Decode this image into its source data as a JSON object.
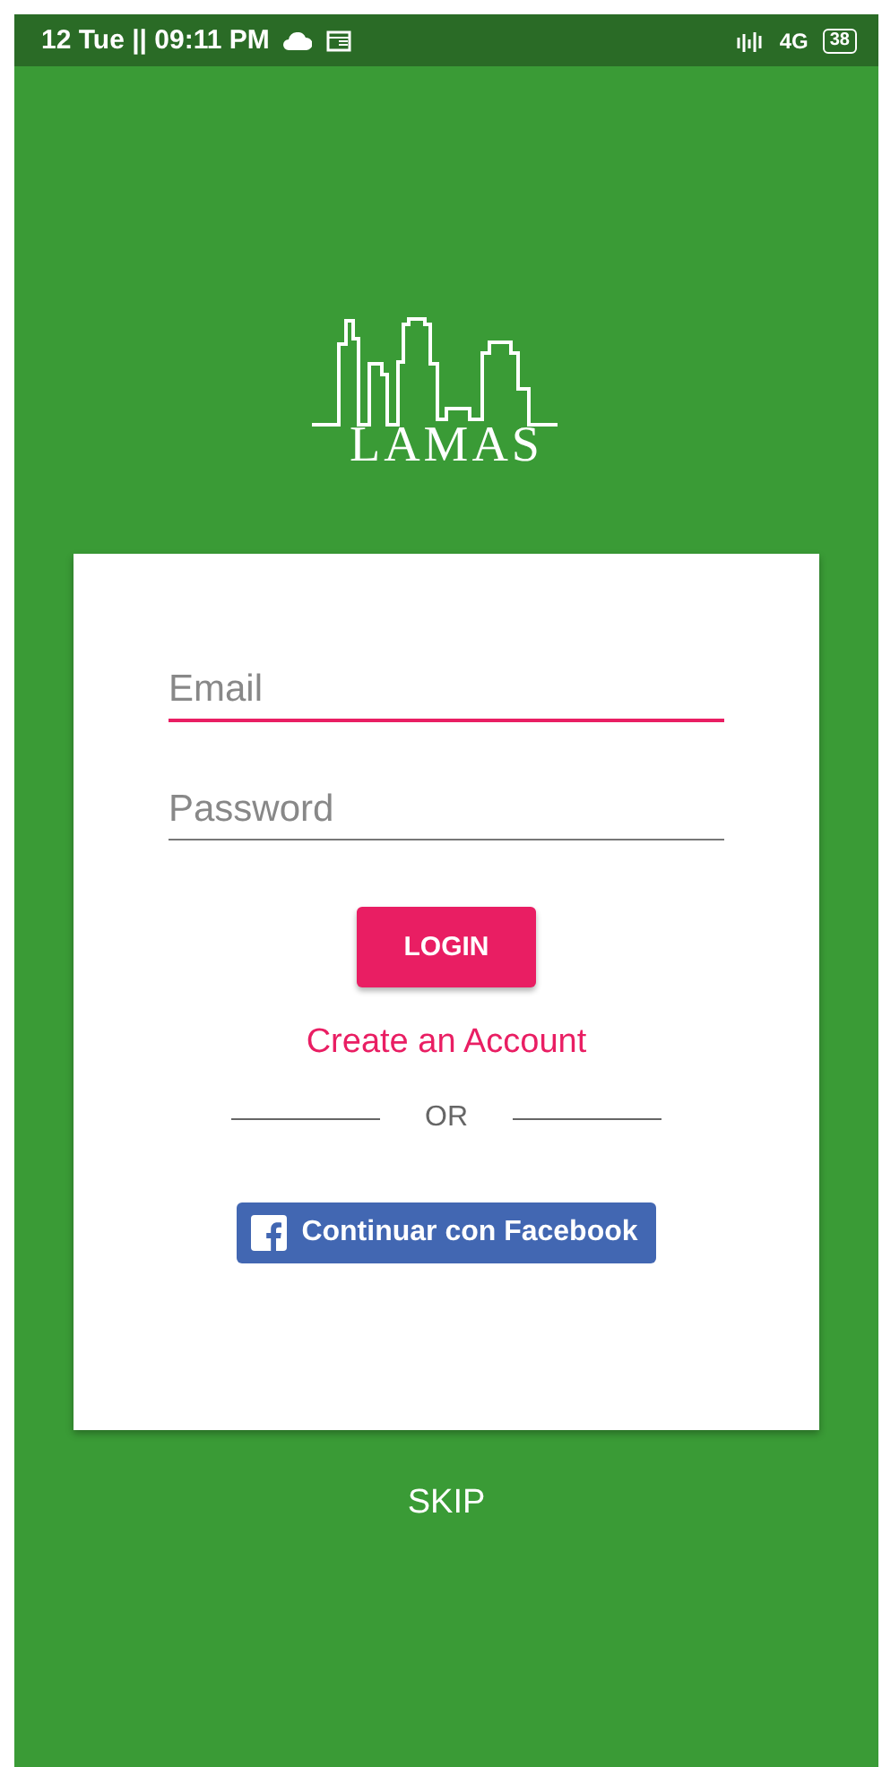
{
  "status_bar": {
    "time": "12 Tue || 09:11 PM",
    "network": "4G",
    "battery": "38"
  },
  "logo": {
    "name": "LAMAS"
  },
  "form": {
    "fields": [
      {
        "placeholder": "Email",
        "focused": true
      },
      {
        "placeholder": "Password",
        "focused": false
      }
    ],
    "login_button": "LOGIN",
    "create_account_link": "Create an Account",
    "divider_text": "OR",
    "facebook_button": "Continuar con Facebook"
  },
  "skip_link": "SKIP"
}
